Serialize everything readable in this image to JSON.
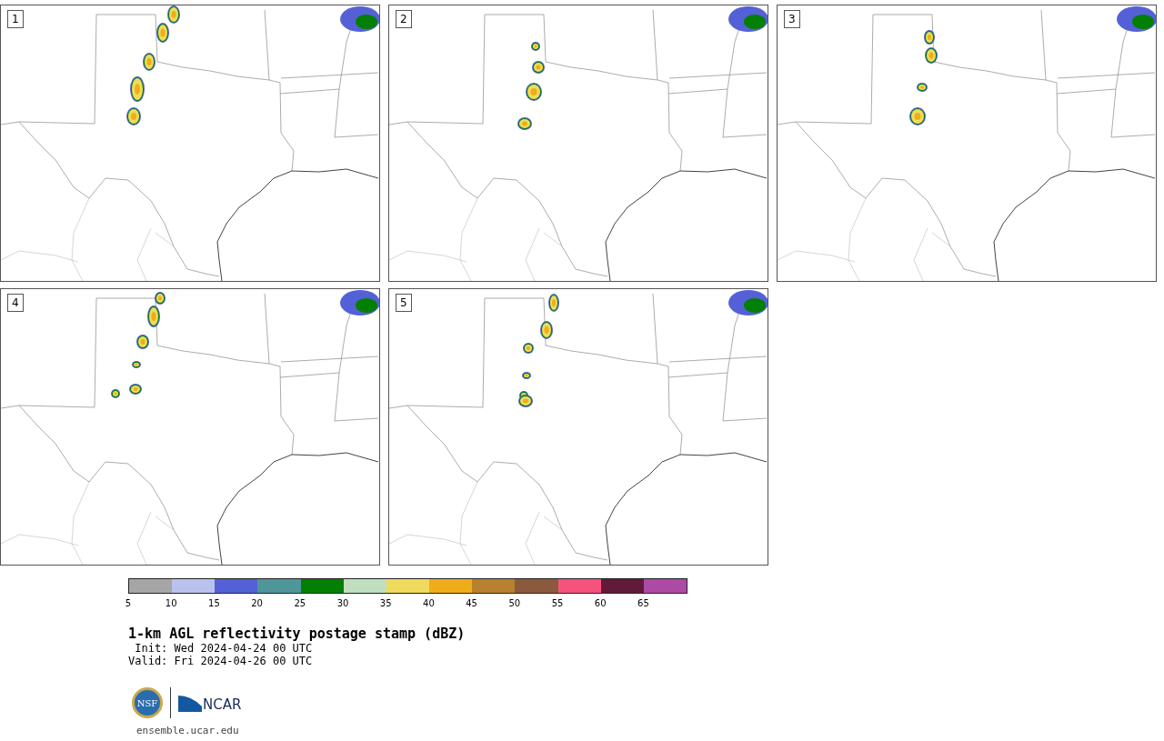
{
  "panels": [
    {
      "label": "1"
    },
    {
      "label": "2"
    },
    {
      "label": "3"
    },
    {
      "label": "4"
    },
    {
      "label": "5"
    }
  ],
  "colorbar": {
    "bins": [
      {
        "color": "#a6a6a6"
      },
      {
        "color": "#b8c2ed"
      },
      {
        "color": "#5461d6"
      },
      {
        "color": "#4f969b"
      },
      {
        "color": "#038003"
      },
      {
        "color": "#bfdfbf"
      },
      {
        "color": "#f0da5d"
      },
      {
        "color": "#efad19"
      },
      {
        "color": "#b8812f"
      },
      {
        "color": "#8b5a3c"
      },
      {
        "color": "#f5537e"
      },
      {
        "color": "#621a39"
      },
      {
        "color": "#ad4aa5"
      }
    ],
    "ticks": [
      "5",
      "10",
      "15",
      "20",
      "25",
      "30",
      "35",
      "40",
      "45",
      "50",
      "55",
      "60",
      "65"
    ]
  },
  "title": "1-km AGL reflectivity postage stamp (dBZ)",
  "init": " Init: Wed 2024-04-24 00 UTC",
  "valid": "Valid: Fri 2024-04-26 00 UTC",
  "logos": {
    "nsf": "NSF",
    "ncar": "NCAR"
  },
  "footer": "ensemble.ucar.edu"
}
